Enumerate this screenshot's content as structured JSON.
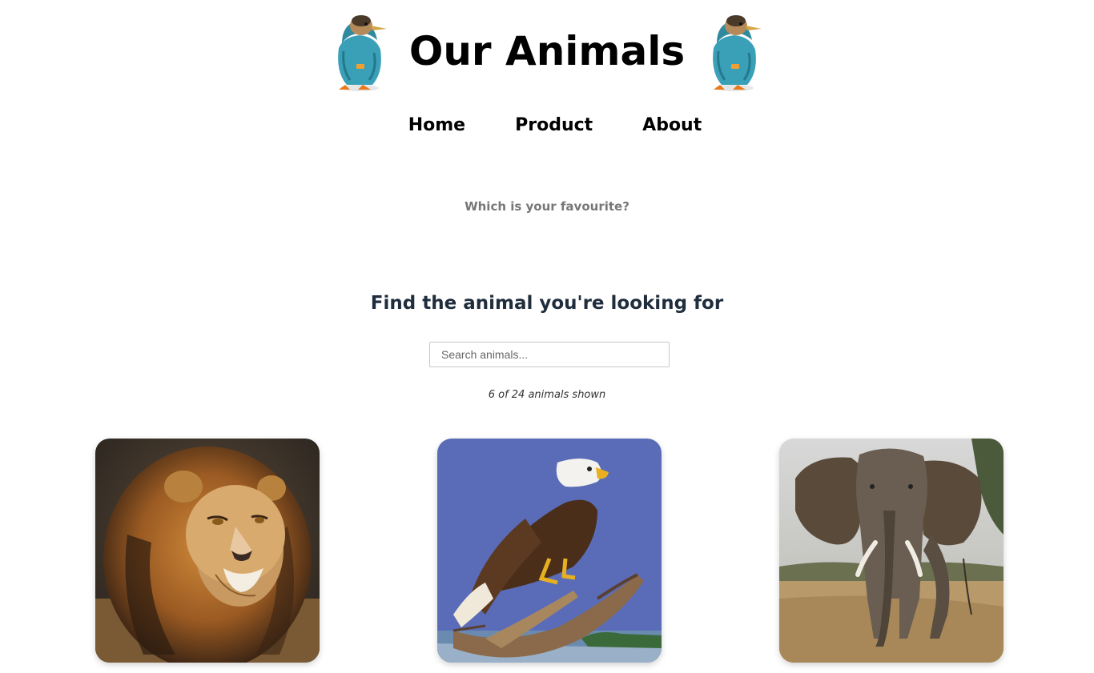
{
  "header": {
    "title": "Our Animals"
  },
  "nav": {
    "items": [
      {
        "label": "Home"
      },
      {
        "label": "Product"
      },
      {
        "label": "About"
      }
    ]
  },
  "tagline": "Which is your favourite?",
  "search": {
    "heading": "Find the animal you're looking for",
    "placeholder": "Search animals...",
    "value": ""
  },
  "results": {
    "count_text": "6 of 24 animals shown"
  },
  "animals": [
    {
      "name": "lion"
    },
    {
      "name": "eagle"
    },
    {
      "name": "elephant"
    }
  ]
}
